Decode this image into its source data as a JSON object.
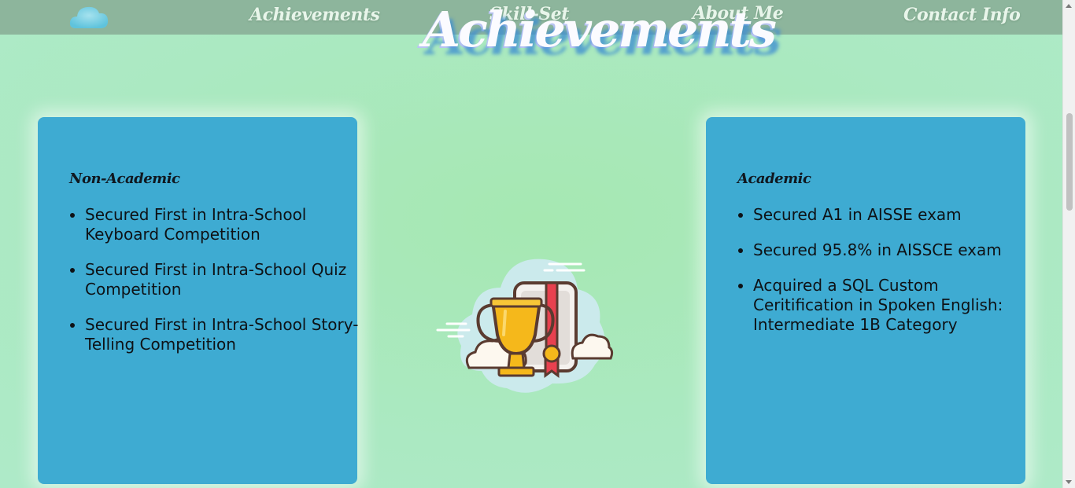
{
  "nav": {
    "logo_icon": "cloud-icon",
    "items": [
      "Achievements",
      "Skill-Set",
      "About Me",
      "Contact Info"
    ]
  },
  "hero": {
    "title": "Achievements"
  },
  "cards": {
    "non_academic": {
      "title": "Non-Academic",
      "items": [
        "Secured First in Intra-School Keyboard Competition",
        "Secured First in Intra-School Quiz Competition",
        "Secured First in Intra-School Story-Telling Competition"
      ]
    },
    "academic": {
      "title": "Academic",
      "items": [
        "Secured A1 in AISSE exam",
        "Secured 95.8% in AISSCE exam",
        "Acquired a SQL Custom Ceritification in Spoken English: Intermediate 1B Category"
      ]
    }
  },
  "illustration": {
    "icon": "trophy-certificate-icon"
  },
  "colors": {
    "background": "#abe9c2",
    "navbar": "#8db59c",
    "card": "#3eabd2",
    "title_shadow": "#3c8cd2"
  }
}
